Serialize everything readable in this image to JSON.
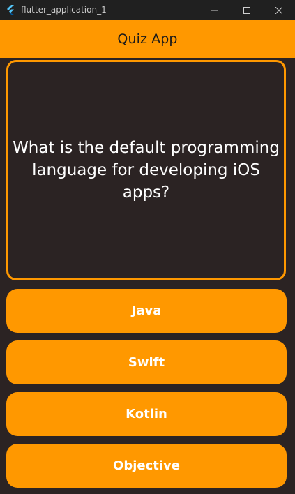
{
  "window": {
    "title": "flutter_application_1",
    "icon": "flutter-icon",
    "controls": [
      "minimize-icon",
      "maximize-icon",
      "close-icon"
    ]
  },
  "appbar": {
    "title": "Quiz App"
  },
  "question": {
    "text": "What is the default programming language for developing iOS apps?"
  },
  "answers": [
    {
      "label": "Java"
    },
    {
      "label": "Swift"
    },
    {
      "label": "Kotlin"
    },
    {
      "label": "Objective"
    }
  ],
  "colors": {
    "accent": "#ff9800",
    "background": "#2b2323",
    "titlebar": "#202020",
    "answer_text": "#ffffff",
    "appbar_text": "#1a1a1a"
  }
}
